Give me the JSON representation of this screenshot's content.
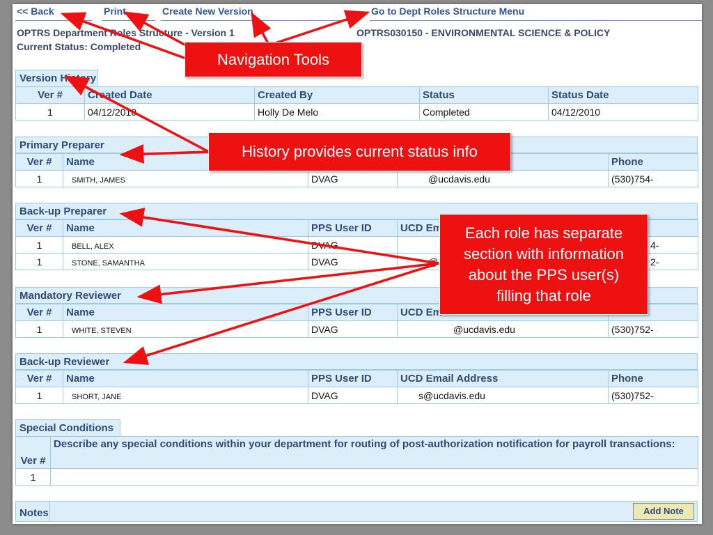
{
  "nav": {
    "back": "<< Back",
    "print": "Print",
    "create_version": "Create New Version",
    "goto_menu": "Go to Dept Roles Structure Menu"
  },
  "header": {
    "title": "OPTRS Department Roles Structure - Version 1",
    "status": "Current Status: Completed",
    "dept": "OPTRS030150 - ENVIRONMENTAL SCIENCE & POLICY"
  },
  "version_history": {
    "title": "Version History",
    "columns": [
      "Ver #",
      "Created Date",
      "Created By",
      "Status",
      "Status Date"
    ],
    "rows": [
      [
        "1",
        "04/12/2010",
        "Holly De Melo",
        "Completed",
        "04/12/2010"
      ]
    ]
  },
  "role_columns": [
    "Ver #",
    "Name",
    "PPS User ID",
    "UCD Email Address",
    "Phone"
  ],
  "roles": [
    {
      "title": "Primary Preparer",
      "columns": [
        "Ver #",
        "Name",
        "",
        "",
        "Phone"
      ],
      "rows": [
        [
          "1",
          "SMITH, JAMES",
          "DVAG",
          "@ucdavis.edu",
          "(530)754-"
        ]
      ]
    },
    {
      "title": "Back-up Preparer",
      "columns": [
        "Ver #",
        "Name",
        "PPS User ID",
        "UCD Em",
        ""
      ],
      "rows": [
        [
          "1",
          "BELL, ALEX",
          "DVAG",
          "",
          "4-"
        ],
        [
          "1",
          "STONE, SAMANTHA",
          "DVAG",
          "@",
          "2-"
        ]
      ]
    },
    {
      "title": "Mandatory Reviewer",
      "columns": [
        "Ver #",
        "Name",
        "PPS User ID",
        "UCD Em",
        ""
      ],
      "rows": [
        [
          "1",
          "WHITE, STEVEN",
          "DVAG",
          "@ucdavis.edu",
          "(530)752-"
        ]
      ]
    },
    {
      "title": "Back-up Reviewer",
      "columns": [
        "Ver #",
        "Name",
        "PPS User ID",
        "UCD Email Address",
        "Phone"
      ],
      "rows": [
        [
          "1",
          "SHORT, JANE",
          "DVAG",
          "s@ucdavis.edu",
          "(530)752-"
        ]
      ]
    }
  ],
  "special_conditions": {
    "title": "Special Conditions",
    "ver_label": "Ver #",
    "description": "Describe any special conditions within your department for routing of post-authorization notification for payroll transactions:",
    "rows": [
      [
        "1",
        ""
      ]
    ]
  },
  "notes": {
    "label": "Notes",
    "add_button": "Add Note"
  },
  "callouts": {
    "nav": "Navigation Tools",
    "history": "History provides current status info",
    "roles": "Each role has separate section with information about the PPS user(s) filling that role"
  },
  "colors": {
    "link": "#335599",
    "header_bg": "#dbeefa",
    "border": "#9ccbe6",
    "callout": "#ee1111"
  }
}
